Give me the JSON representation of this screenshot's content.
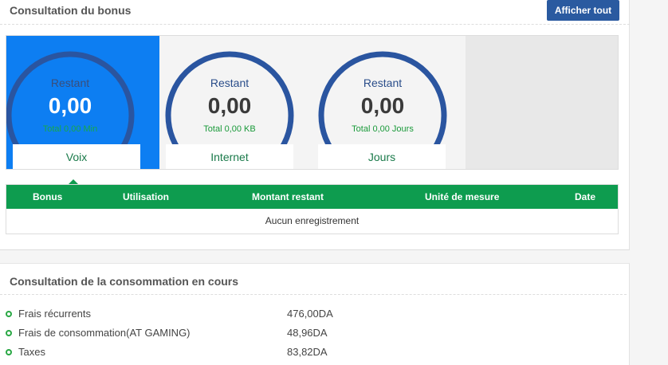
{
  "bonus": {
    "title": "Consultation du bonus",
    "show_all_label": "Afficher tout",
    "gauges": [
      {
        "label": "Restant",
        "value": "0,00",
        "total": "Total 0,00 Min",
        "tab": "Voix",
        "active": true
      },
      {
        "label": "Restant",
        "value": "0,00",
        "total": "Total 0,00 KB",
        "tab": "Internet",
        "active": false
      },
      {
        "label": "Restant",
        "value": "0,00",
        "total": "Total 0,00 Jours",
        "tab": "Jours",
        "active": false
      }
    ],
    "table": {
      "headers": [
        "Bonus",
        "Utilisation",
        "Montant restant",
        "Unité de mesure",
        "Date"
      ],
      "empty_message": "Aucun enregistrement"
    }
  },
  "consumption": {
    "title": "Consultation de la consommation en cours",
    "items": [
      {
        "label": "Frais récurrents",
        "value": "476,00DA"
      },
      {
        "label": "Frais de consommation(AT GAMING)",
        "value": "48,96DA"
      },
      {
        "label": "Taxes",
        "value": "83,82DA"
      }
    ]
  },
  "colors": {
    "primary_blue": "#2a5aa0",
    "active_blue": "#0d7ef2",
    "green": "#0e9c4f",
    "gauge_ring": "#2a55a0"
  }
}
